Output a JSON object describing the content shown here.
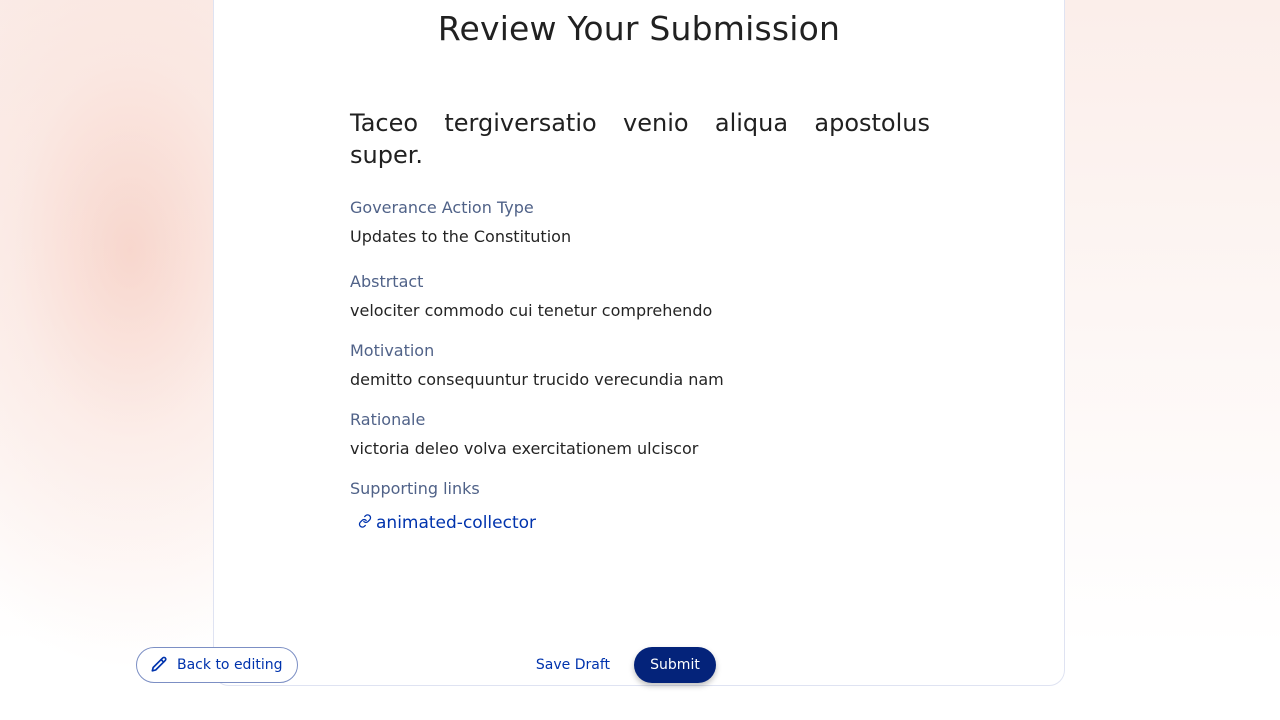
{
  "page": {
    "title": "Review Your Submission"
  },
  "proposal": {
    "title": "Taceo tergiversatio venio aliqua apostolus super.",
    "fields": [
      {
        "label": "Goverance Action Type",
        "value": "Updates to the Constitution"
      },
      {
        "label": "Abstrtact",
        "value": "velociter commodo cui tenetur comprehendo"
      },
      {
        "label": "Motivation",
        "value": "demitto consequuntur trucido verecundia nam"
      },
      {
        "label": "Rationale",
        "value": "victoria deleo volva exercitationem ulciscor"
      }
    ],
    "supporting_links": {
      "label": "Supporting links",
      "items": [
        {
          "text": "animated-collector",
          "icon": "link-icon"
        }
      ]
    }
  },
  "footer": {
    "back_label": "Back to editing",
    "back_icon": "pencil-icon",
    "save_draft_label": "Save Draft",
    "submit_label": "Submit"
  },
  "colors": {
    "primary": "#0033ad",
    "submit_bg": "#04237a",
    "label": "#506288",
    "text": "#242424"
  }
}
